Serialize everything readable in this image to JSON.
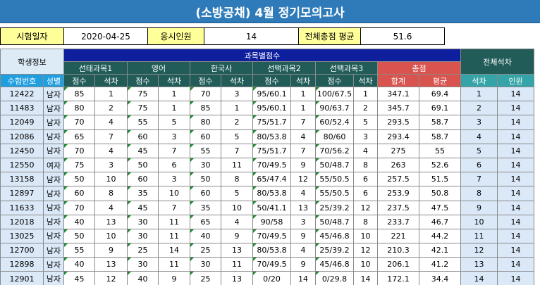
{
  "title": "(소방공채) 4월 정기모의고사",
  "info": {
    "exam_date_label": "시험일자",
    "exam_date": "2020-04-25",
    "applicants_label": "응시인원",
    "applicants": "14",
    "avg_label": "전체총점 평균",
    "avg": "51.6"
  },
  "headers": {
    "student_info": "학생정보",
    "subject_scores": "과목별점수",
    "overall_rank": "전체석차",
    "subjects": [
      "선태과목1",
      "영어",
      "한국사",
      "선택과목2",
      "선택과목3"
    ],
    "total": "총점",
    "exam_no": "수험번호",
    "gender": "성별",
    "score": "점수",
    "rank": "석차",
    "sum": "합계",
    "average": "평균",
    "overall_rank_col": "석차",
    "headcount": "인원"
  },
  "rows": [
    {
      "id": "12422",
      "gender": "남자",
      "s1": "85",
      "r1": "1",
      "s2": "75",
      "r2": "1",
      "s3": "70",
      "r3": "3",
      "s4": "95/60.1",
      "r4": "1",
      "s5": "100/67.5",
      "r5": "1",
      "sum": "347.1",
      "avg": "69.4",
      "rank": "1",
      "count": "14"
    },
    {
      "id": "11483",
      "gender": "남자",
      "s1": "80",
      "r1": "2",
      "s2": "75",
      "r2": "1",
      "s3": "85",
      "r3": "1",
      "s4": "95/60.1",
      "r4": "1",
      "s5": "90/63.7",
      "r5": "2",
      "sum": "345.7",
      "avg": "69.1",
      "rank": "2",
      "count": "14"
    },
    {
      "id": "12049",
      "gender": "남자",
      "s1": "70",
      "r1": "4",
      "s2": "55",
      "r2": "5",
      "s3": "80",
      "r3": "2",
      "s4": "75/51.7",
      "r4": "7",
      "s5": "60/52.4",
      "r5": "5",
      "sum": "293.5",
      "avg": "58.7",
      "rank": "3",
      "count": "14"
    },
    {
      "id": "12086",
      "gender": "남자",
      "s1": "65",
      "r1": "7",
      "s2": "60",
      "r2": "3",
      "s3": "60",
      "r3": "5",
      "s4": "80/53.8",
      "r4": "4",
      "s5": "80/60",
      "r5": "3",
      "sum": "293.4",
      "avg": "58.7",
      "rank": "4",
      "count": "14"
    },
    {
      "id": "12450",
      "gender": "남자",
      "s1": "70",
      "r1": "4",
      "s2": "45",
      "r2": "7",
      "s3": "55",
      "r3": "7",
      "s4": "75/51.7",
      "r4": "7",
      "s5": "70/56.2",
      "r5": "4",
      "sum": "275",
      "avg": "55",
      "rank": "5",
      "count": "14"
    },
    {
      "id": "12550",
      "gender": "여자",
      "s1": "75",
      "r1": "3",
      "s2": "50",
      "r2": "6",
      "s3": "30",
      "r3": "11",
      "s4": "70/49.5",
      "r4": "9",
      "s5": "50/48.7",
      "r5": "8",
      "sum": "263",
      "avg": "52.6",
      "rank": "6",
      "count": "14"
    },
    {
      "id": "13158",
      "gender": "남자",
      "s1": "50",
      "r1": "10",
      "s2": "60",
      "r2": "3",
      "s3": "50",
      "r3": "8",
      "s4": "65/47.4",
      "r4": "12",
      "s5": "55/50.5",
      "r5": "6",
      "sum": "257.5",
      "avg": "51.5",
      "rank": "7",
      "count": "14"
    },
    {
      "id": "12897",
      "gender": "남자",
      "s1": "60",
      "r1": "8",
      "s2": "35",
      "r2": "10",
      "s3": "60",
      "r3": "5",
      "s4": "80/53.8",
      "r4": "4",
      "s5": "55/50.5",
      "r5": "6",
      "sum": "253.9",
      "avg": "50.8",
      "rank": "8",
      "count": "14"
    },
    {
      "id": "11633",
      "gender": "남자",
      "s1": "70",
      "r1": "4",
      "s2": "45",
      "r2": "7",
      "s3": "35",
      "r3": "10",
      "s4": "50/41.1",
      "r4": "13",
      "s5": "25/39.2",
      "r5": "12",
      "sum": "237.5",
      "avg": "47.5",
      "rank": "9",
      "count": "14"
    },
    {
      "id": "12018",
      "gender": "남자",
      "s1": "40",
      "r1": "13",
      "s2": "30",
      "r2": "11",
      "s3": "65",
      "r3": "4",
      "s4": "90/58",
      "r4": "3",
      "s5": "50/48.7",
      "r5": "8",
      "sum": "233.7",
      "avg": "46.7",
      "rank": "10",
      "count": "14"
    },
    {
      "id": "13025",
      "gender": "남자",
      "s1": "50",
      "r1": "10",
      "s2": "30",
      "r2": "11",
      "s3": "40",
      "r3": "9",
      "s4": "70/49.5",
      "r4": "9",
      "s5": "45/46.8",
      "r5": "10",
      "sum": "221",
      "avg": "44.2",
      "rank": "11",
      "count": "14"
    },
    {
      "id": "12700",
      "gender": "남자",
      "s1": "55",
      "r1": "9",
      "s2": "25",
      "r2": "14",
      "s3": "25",
      "r3": "13",
      "s4": "80/53.8",
      "r4": "4",
      "s5": "25/39.2",
      "r5": "12",
      "sum": "210.3",
      "avg": "42.1",
      "rank": "12",
      "count": "14"
    },
    {
      "id": "12898",
      "gender": "남자",
      "s1": "40",
      "r1": "13",
      "s2": "30",
      "r2": "11",
      "s3": "30",
      "r3": "11",
      "s4": "70/49.5",
      "r4": "9",
      "s5": "45/46.8",
      "r5": "10",
      "sum": "206.1",
      "avg": "41.2",
      "rank": "13",
      "count": "14"
    },
    {
      "id": "12901",
      "gender": "남자",
      "s1": "45",
      "r1": "12",
      "s2": "40",
      "r2": "9",
      "s3": "25",
      "r3": "13",
      "s4": "0/20",
      "r4": "14",
      "s5": "0/29.8",
      "r5": "14",
      "sum": "172.1",
      "avg": "34.4",
      "rank": "14",
      "count": "14"
    }
  ]
}
